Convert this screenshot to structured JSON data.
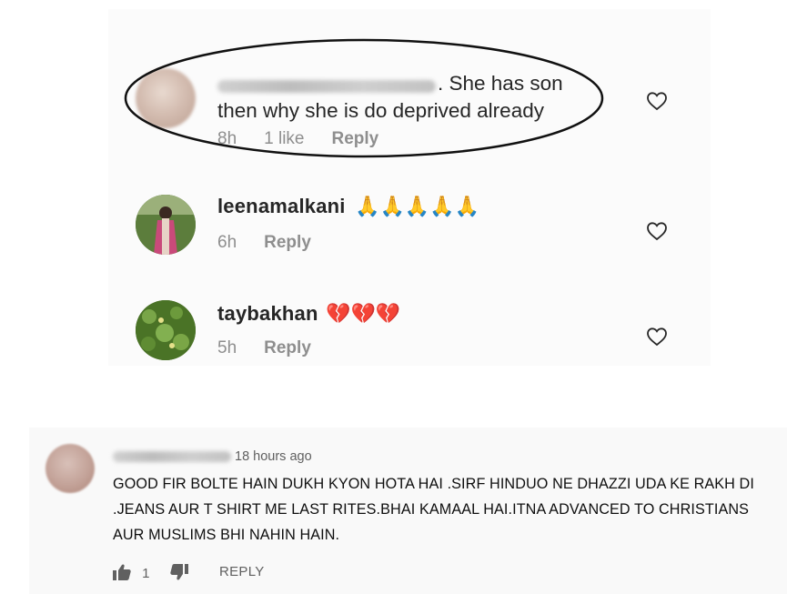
{
  "instagram": {
    "comments": [
      {
        "text": ". She has son then why she is do deprived already",
        "time": "8h",
        "likes": "1 like",
        "reply": "Reply"
      },
      {
        "username": "leenamalkani",
        "emoji": "🙏🙏🙏🙏🙏",
        "time": "6h",
        "reply": "Reply"
      },
      {
        "username": "taybakhan",
        "emoji": "💔💔💔",
        "time": "5h",
        "reply": "Reply"
      }
    ],
    "icons": [
      "heart-outline-icon"
    ]
  },
  "youtube": {
    "time": "18 hours ago",
    "text": "GOOD FIR BOLTE HAIN DUKH KYON HOTA HAI .SIRF HINDUO NE DHAZZI UDA KE RAKH DI .JEANS AUR T SHIRT ME LAST RITES.BHAI KAMAAL HAI.ITNA ADVANCED TO CHRISTIANS AUR MUSLIMS BHI NAHIN HAIN.",
    "likes": "1",
    "reply": "REPLY",
    "icons": [
      "thumbs-up-icon",
      "thumbs-down-icon"
    ]
  }
}
